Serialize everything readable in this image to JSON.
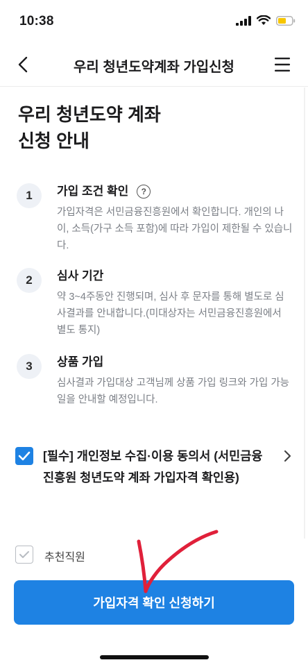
{
  "status_bar": {
    "time": "10:38"
  },
  "nav": {
    "title": "우리 청년도약계좌 가입신청"
  },
  "page": {
    "title_line1": "우리 청년도약 계좌",
    "title_line2": "신청 안내"
  },
  "steps": [
    {
      "number": "1",
      "title": "가입 조건 확인",
      "desc": "가입자격은 서민금융진흥원에서 확인합니다. 개인의 나이, 소득(가구 소득 포함)에 따라 가입이 제한될 수 있습니다."
    },
    {
      "number": "2",
      "title": "심사 기간",
      "desc": "약 3~4주동안 진행되며, 심사 후 문자를 통해 별도로 심사결과를 안내합니다.(미대상자는 서민금융진흥원에서 별도 통지)"
    },
    {
      "number": "3",
      "title": "상품 가입",
      "desc": "심사결과 가입대상 고객님께 상품 가입 링크와 가입 가능일을 안내할 예정입니다."
    }
  ],
  "consent": {
    "label": "[필수] 개인정보 수집·이용 동의서 (서민금융진흥원 청년도약 계좌 가입자격 확인용)",
    "checked": true
  },
  "recommend": {
    "label": "추천직원",
    "checked": false
  },
  "cta": {
    "label": "가입자격 확인 신청하기"
  },
  "colors": {
    "primary": "#1e82e3",
    "annotation": "#e0203a",
    "step_badge": "#eef1f6"
  },
  "icons": [
    "back-arrow-icon",
    "menu-icon",
    "help-icon",
    "checkmark-icon",
    "chevron-right-icon",
    "cellular-icon",
    "wifi-icon",
    "battery-icon"
  ]
}
